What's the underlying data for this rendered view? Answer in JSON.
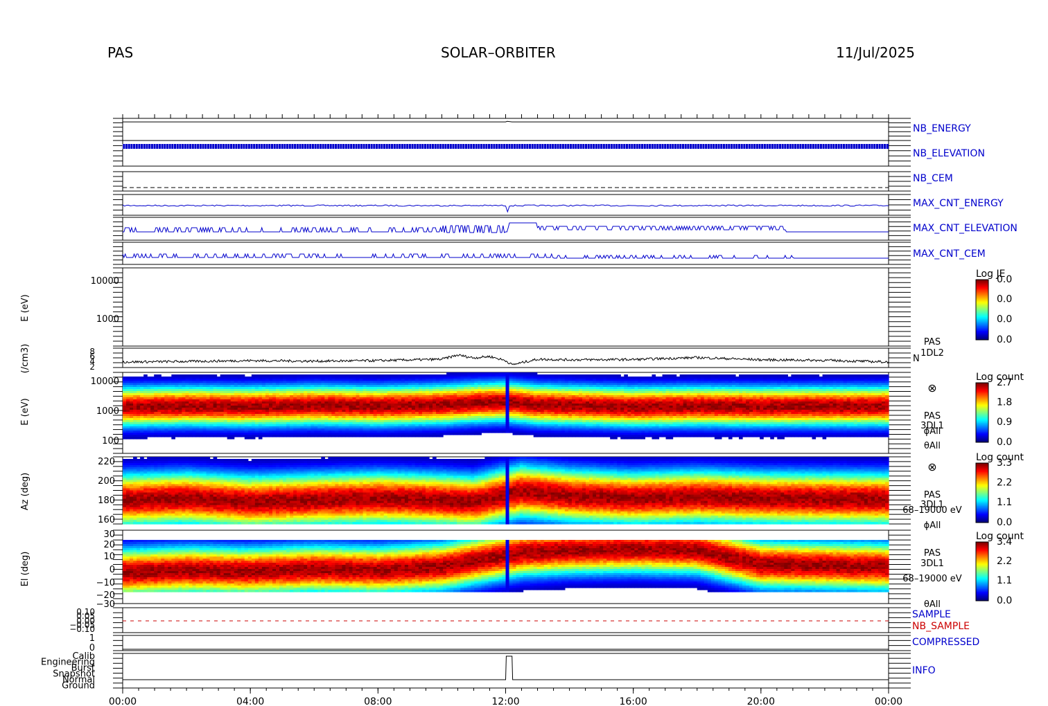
{
  "header": {
    "instrument": "PAS",
    "mission": "SOLAR–ORBITER",
    "date": "11/Jul/2025"
  },
  "colors": {
    "series_blue": "#0000cc",
    "label_red": "#cc0000",
    "axis": "#000000"
  },
  "time_axis": {
    "ticks": [
      "00:00",
      "04:00",
      "08:00",
      "12:00",
      "16:00",
      "20:00",
      "00:00"
    ],
    "range_hours": [
      0,
      24
    ]
  },
  "panels": {
    "nb_energy": {
      "label": "NB_ENERGY"
    },
    "nb_elevation": {
      "label": "NB_ELEVATION"
    },
    "nb_cem": {
      "label": "NB_CEM"
    },
    "max_cnt_energy": {
      "label": "MAX_CNT_ENERGY"
    },
    "max_cnt_elevation": {
      "label": "MAX_CNT_ELEVATION"
    },
    "max_cnt_cem": {
      "label": "MAX_CNT_CEM"
    },
    "energy_1dl2": {
      "ylabel": "E (eV)",
      "yticks": [
        "10000",
        "1000"
      ],
      "cbar_title": "Log JE",
      "cbar_ticks": [
        "0.0",
        "0.0",
        "0.0",
        "0.0"
      ]
    },
    "density": {
      "ylabel": "(/cm3)",
      "yticks": [
        "8",
        "6",
        "4",
        "2"
      ],
      "side_lines": [
        "PAS",
        "1DL2",
        "N"
      ]
    },
    "energy_3dl1": {
      "ylabel": "E (eV)",
      "yticks": [
        "10000",
        "1000",
        "100"
      ],
      "cbar_title": "Log count",
      "cbar_ticks": [
        "2.7",
        "1.8",
        "0.9",
        "0.0"
      ],
      "symbol": "⊗",
      "side_lines": [
        "PAS",
        "3DL1",
        "ϕAll",
        "θAll"
      ]
    },
    "azimuth": {
      "ylabel": "Az (deg)",
      "yticks": [
        "220",
        "200",
        "180",
        "160"
      ],
      "cbar_title": "Log count",
      "cbar_ticks": [
        "3.3",
        "2.2",
        "1.1",
        "0.0"
      ],
      "symbol": "⊗",
      "side_lines": [
        "PAS",
        "3DL1",
        "68–19000 eV",
        "ϕAll"
      ]
    },
    "elevation": {
      "ylabel": "El (deg)",
      "yticks": [
        "30",
        "20",
        "10",
        "0",
        "−10",
        "−20",
        "−30"
      ],
      "cbar_title": "Log count",
      "cbar_ticks": [
        "3.4",
        "2.2",
        "1.1",
        "0.0"
      ],
      "side_lines": [
        "PAS",
        "3DL1",
        "68–19000 eV",
        "θAll"
      ]
    },
    "sample": {
      "labels": [
        "SAMPLE",
        "NB_SAMPLE"
      ],
      "yticks": [
        "0.10",
        "0.05",
        "0.00",
        "−0.05",
        "−0.10"
      ]
    },
    "compressed": {
      "label": "COMPRESSED",
      "yticks": [
        "1",
        "0"
      ]
    },
    "info": {
      "label": "INFO",
      "modes": [
        "Calib",
        "Engineering",
        "Burst",
        "Snapshot",
        "Normal",
        "Ground"
      ]
    }
  },
  "chart_data": [
    {
      "type": "line",
      "title": "NB_ENERGY",
      "x": [
        0,
        12.0,
        12.05,
        12.2,
        24
      ],
      "values": [
        96,
        96,
        99,
        96,
        96
      ],
      "ylim": [
        0,
        100
      ],
      "note": ""
    },
    {
      "type": "line",
      "title": "N",
      "ylabel": "(/cm3)",
      "x": [
        0,
        2,
        4,
        6,
        8,
        10,
        10.5,
        11,
        11.5,
        12,
        12.2,
        13,
        14,
        16,
        18,
        20,
        22,
        24
      ],
      "values": [
        4.0,
        4.2,
        4.5,
        4.3,
        4.5,
        5.0,
        6.5,
        5.5,
        6.0,
        4.5,
        3.0,
        5.0,
        4.8,
        4.9,
        5.6,
        4.8,
        4.6,
        4.0
      ],
      "ylim": [
        2,
        9
      ]
    },
    {
      "type": "heatmap",
      "title": "PAS 3DL1 energy",
      "ylabel": "E (eV)",
      "x_range_hours": [
        0,
        24
      ],
      "peak_energy_eV": [
        1800,
        1900,
        1850,
        2000,
        1900,
        2100,
        2400,
        2600,
        2100,
        1800,
        1900,
        1850,
        1900
      ],
      "peak_x_hours": [
        0,
        2,
        4,
        6,
        8,
        10,
        11,
        12,
        13,
        16,
        18,
        20,
        24
      ],
      "ylim": [
        60,
        20000
      ]
    },
    {
      "type": "heatmap",
      "title": "PAS 3DL1 azimuth",
      "ylabel": "Az (deg)",
      "peak_az_deg": [
        180,
        182,
        178,
        180,
        182,
        180,
        178,
        190,
        185,
        182,
        184,
        182,
        181
      ],
      "peak_x_hours": [
        0,
        2,
        4,
        6,
        8,
        10,
        11,
        12.5,
        14,
        16,
        18,
        20,
        24
      ],
      "ylim": [
        152,
        228
      ]
    },
    {
      "type": "heatmap",
      "title": "PAS 3DL1 elevation",
      "ylabel": "El (deg)",
      "peak_el_deg": [
        -5,
        -3,
        -4,
        -2,
        -3,
        0,
        5,
        12,
        14,
        15,
        14,
        2,
        0
      ],
      "peak_x_hours": [
        0,
        2,
        4,
        6,
        8,
        10,
        11,
        12.5,
        14,
        16,
        18,
        20,
        24
      ],
      "ylim": [
        -30,
        30
      ]
    },
    {
      "type": "line",
      "title": "INFO",
      "x": [
        0,
        12.0,
        12.02,
        12.2,
        12.22,
        24
      ],
      "values": [
        "Normal",
        "Normal",
        "Calib",
        "Calib",
        "Normal",
        "Normal"
      ]
    }
  ]
}
